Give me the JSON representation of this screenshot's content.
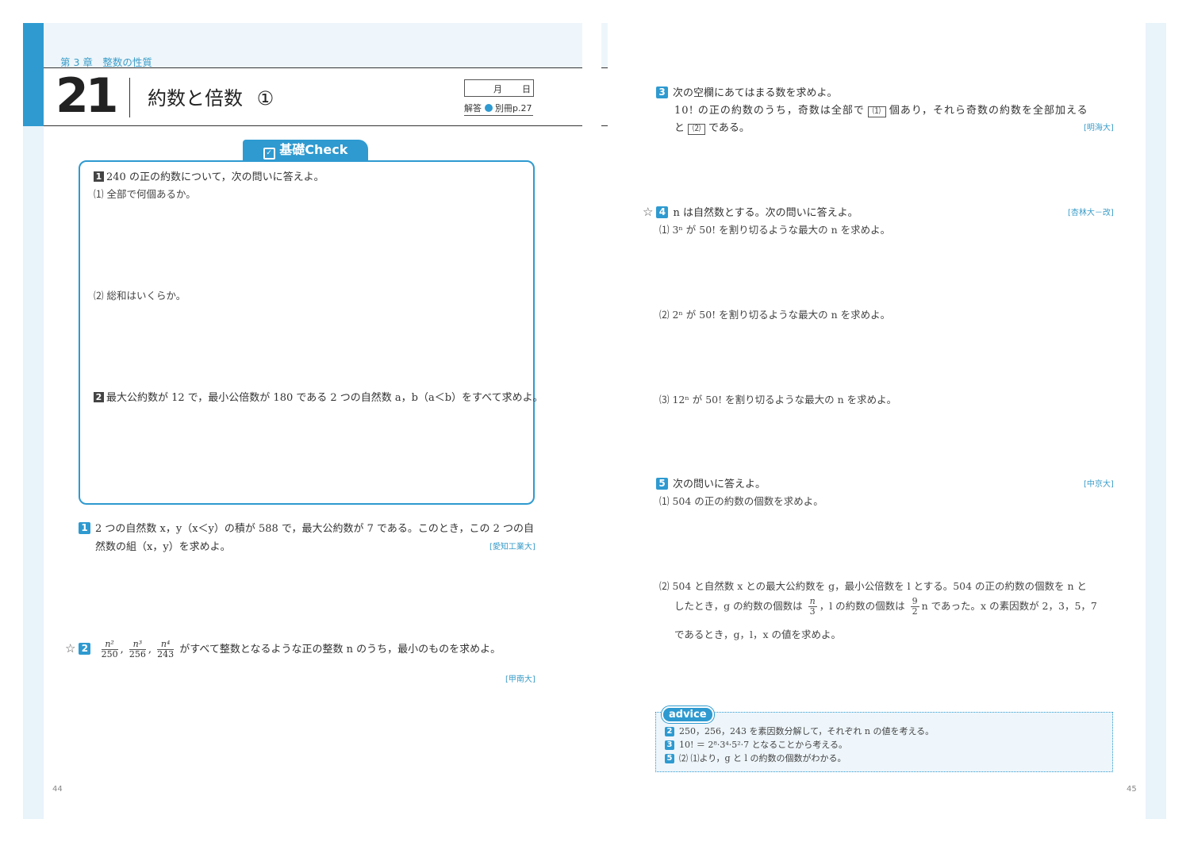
{
  "colors": {
    "accent": "#2e9ad0",
    "band": "#e8f3fa",
    "text": "#333333"
  },
  "left": {
    "chapter": "第 3 章　整数の性質",
    "lesson_number": "21",
    "lesson_title": "約数と倍数",
    "lesson_circle": "①",
    "date_month": "月",
    "date_day": "日",
    "answer_label": "解答",
    "answer_ref": "別冊p.27",
    "kiso_label": "基礎Check",
    "check1_text": "240 の正の約数について，次の問いに答えよ。",
    "check1_sub1": "⑴ 全部で何個あるか。",
    "check1_sub2": "⑵ 総和はいくらか。",
    "check2_text": "最大公約数が 12 で，最小公倍数が 180 である 2 つの自然数 a，b（a＜b）をすべて求めよ。",
    "p1_line1": "2 つの自然数 x，y（x＜y）の積が 588 で，最大公約数が 7 である。このとき，この 2 つの自",
    "p1_line2": "然数の組（x，y）を求めよ。",
    "p1_source": "[愛知工業大]",
    "p2_frac": [
      {
        "n": "n²",
        "d": "250"
      },
      {
        "n": "n³",
        "d": "256"
      },
      {
        "n": "n⁴",
        "d": "243"
      }
    ],
    "p2_text": "がすべて整数となるような正の整数 n のうち，最小のものを求めよ。",
    "p2_source": "[甲南大]",
    "page_number": "44"
  },
  "right": {
    "p3_line1": "次の空欄にあてはまる数を求めよ。",
    "p3_line2a": "10! の正の約数のうち，奇数は全部で",
    "p3_box1": "⑴",
    "p3_line2b": "個あり，それら奇数の約数を全部加える",
    "p3_line3a": "と",
    "p3_box2": "⑵",
    "p3_line3b": "である。",
    "p3_source": "[明海大]",
    "p4_text": "n は自然数とする。次の問いに答えよ。",
    "p4_source": "[杏林大－改]",
    "p4_sub1": "⑴ 3ⁿ が 50! を割り切るような最大の n を求めよ。",
    "p4_sub2": "⑵ 2ⁿ が 50! を割り切るような最大の n を求めよ。",
    "p4_sub3": "⑶ 12ⁿ が 50! を割り切るような最大の n を求めよ。",
    "p5_text": "次の問いに答えよ。",
    "p5_source": "[中京大]",
    "p5_sub1": "⑴ 504 の正の約数の個数を求めよ。",
    "p5_sub2_l1": "⑵ 504 と自然数 x との最大公約数を g，最小公倍数を l とする。504 の正の約数の個数を n と",
    "p5_sub2_l2a": "したとき，g の約数の個数は",
    "p5_frac1": {
      "n": "n",
      "d": "3"
    },
    "p5_sub2_l2b": "，l の約数の個数は",
    "p5_frac2": {
      "n": "9",
      "d": "2"
    },
    "p5_sub2_l2c": "n であった。x の素因数が 2，3，5，7",
    "p5_sub2_l3": "であるとき，g，l，x の値を求めよ。",
    "advice_label": "advice",
    "advice": [
      {
        "num": "2",
        "text": "250，256，243 を素因数分解して，それぞれ n の値を考える。"
      },
      {
        "num": "3",
        "text": "10! ＝ 2⁸·3⁴·5²·7 となることから考える。"
      },
      {
        "num": "5",
        "text": "⑵ ⑴より，g と l の約数の個数がわかる。"
      }
    ],
    "page_number": "45"
  }
}
